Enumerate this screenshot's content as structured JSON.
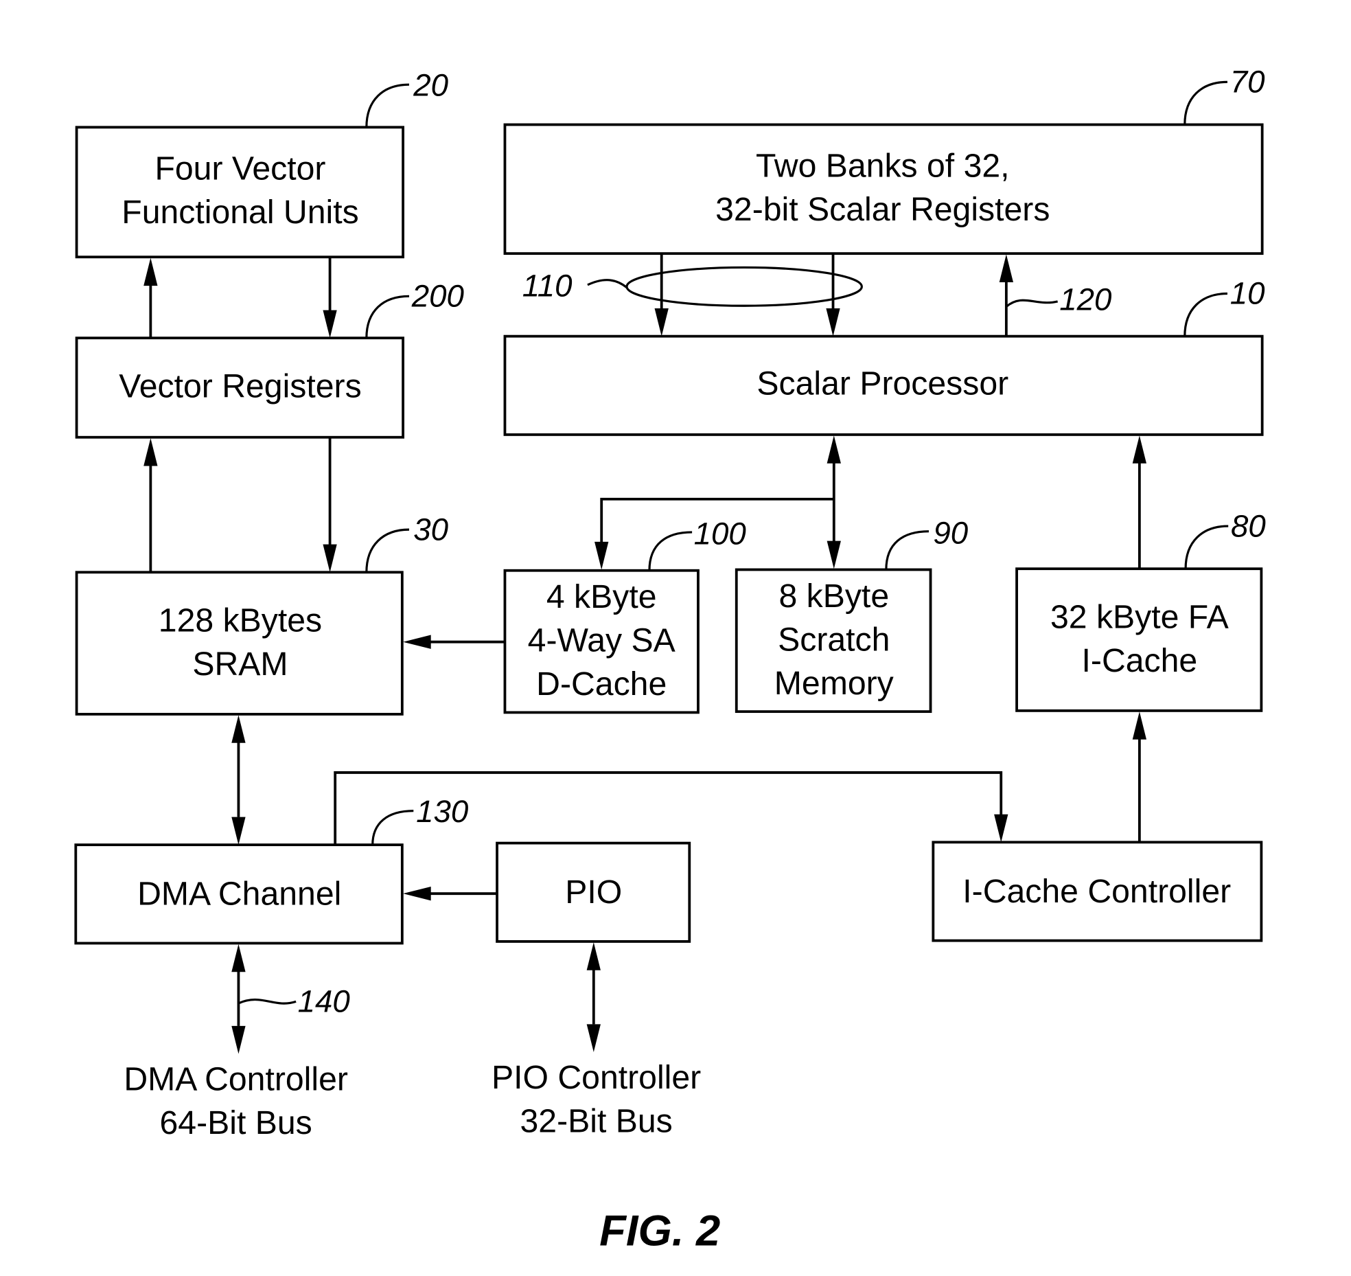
{
  "figure": {
    "caption": "FIG. 2",
    "blocks": [
      {
        "id": "vfu",
        "lines": [
          "Four Vector",
          "Functional Units"
        ],
        "ref": "20"
      },
      {
        "id": "vreg",
        "lines": [
          "Vector Registers"
        ],
        "ref": "200"
      },
      {
        "id": "sram",
        "lines": [
          "128 kBytes",
          "SRAM"
        ],
        "ref": "30"
      },
      {
        "id": "dma",
        "lines": [
          "DMA Channel"
        ],
        "ref": "130"
      },
      {
        "id": "pio",
        "lines": [
          "PIO"
        ],
        "ref": ""
      },
      {
        "id": "sreg",
        "lines": [
          "Two Banks of 32,",
          "32-bit Scalar Registers"
        ],
        "ref": "70"
      },
      {
        "id": "sp",
        "lines": [
          "Scalar Processor"
        ],
        "ref": "10"
      },
      {
        "id": "dcache",
        "lines": [
          "4 kByte",
          "4-Way SA",
          "D-Cache"
        ],
        "ref": "100"
      },
      {
        "id": "scratch",
        "lines": [
          "8 kByte",
          "Scratch",
          "Memory"
        ],
        "ref": "90"
      },
      {
        "id": "icache",
        "lines": [
          "32 kByte FA",
          "I-Cache"
        ],
        "ref": "80"
      },
      {
        "id": "icc",
        "lines": [
          "I-Cache Controller"
        ],
        "ref": ""
      }
    ],
    "external": [
      {
        "id": "dmactl",
        "lines": [
          "DMA Controller",
          "64-Bit Bus"
        ],
        "ref": "140"
      },
      {
        "id": "pioctl",
        "lines": [
          "PIO Controller",
          "32-Bit Bus"
        ],
        "ref": ""
      }
    ],
    "bus_refs": {
      "reg_to_sp": "110",
      "sp_to_reg": "120"
    }
  }
}
